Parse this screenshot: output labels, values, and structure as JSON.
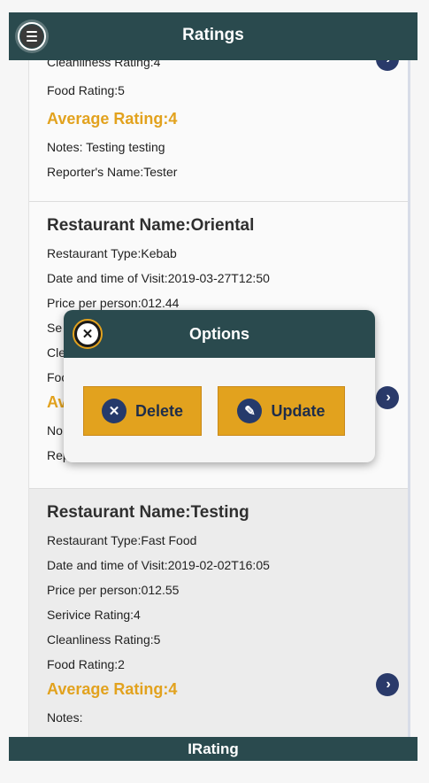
{
  "header": {
    "title": "Ratings"
  },
  "footer": {
    "title": "IRating"
  },
  "items": [
    {
      "lines": {
        "cleanliness": "Cleanliness Rating:4",
        "food": "Food Rating:5",
        "average": "Average Rating:4",
        "notes": "Notes: Testing testing",
        "reporter": "Reporter's Name:Tester"
      }
    },
    {
      "name": "Restaurant Name:Oriental",
      "lines": {
        "type": "Restaurant Type:Kebab",
        "visit": "Date and time of Visit:2019-03-27T12:50",
        "price": "Price per person:012.44",
        "service": "Se",
        "cleanliness": "Cle",
        "food": "Foo",
        "average": "Av",
        "notes": "No",
        "reporter": "Rep"
      }
    },
    {
      "name": "Restaurant Name:Testing",
      "lines": {
        "type": "Restaurant Type:Fast Food",
        "visit": "Date and time of Visit:2019-02-02T16:05",
        "price": "Price per person:012.55",
        "service": "Serivice Rating:4",
        "cleanliness": "Cleanliness Rating:5",
        "food": "Food Rating:2",
        "average": "Average Rating:4",
        "notes": "Notes:"
      }
    }
  ],
  "dialog": {
    "title": "Options",
    "delete_label": "Delete",
    "update_label": "Update"
  },
  "icons": {
    "menu": "menu-icon",
    "arrow": "chevron-right-icon",
    "close": "close-icon",
    "delete": "delete-icon",
    "update": "pencil-icon"
  },
  "colors": {
    "header": "#2a4a4e",
    "accent": "#e2a21e",
    "icon_blue": "#253a6b"
  }
}
